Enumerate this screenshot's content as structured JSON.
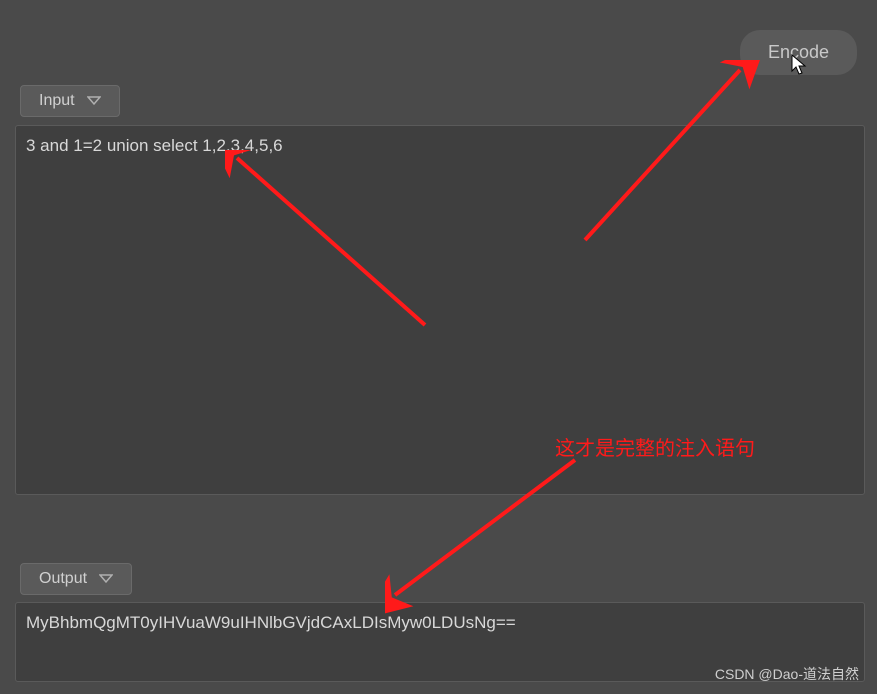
{
  "header": {
    "encode_label": "Encode"
  },
  "input": {
    "label": "Input",
    "value": "3 and 1=2 union select 1,2,3,4,5,6"
  },
  "output": {
    "label": "Output",
    "value": "MyBhbmQgMT0yIHVuaW9uIHNlbGVjdCAxLDIsMyw0LDUsNg=="
  },
  "annotations": {
    "note1": "这才是完整的注入语句"
  },
  "watermark": "CSDN @Dao-道法自然",
  "colors": {
    "annotation": "#ff1a1a",
    "bg": "#4a4a4a",
    "box": "#3f3f3f"
  },
  "icons": {
    "chevron": "chevron-down-icon",
    "cursor": "cursor-icon"
  }
}
